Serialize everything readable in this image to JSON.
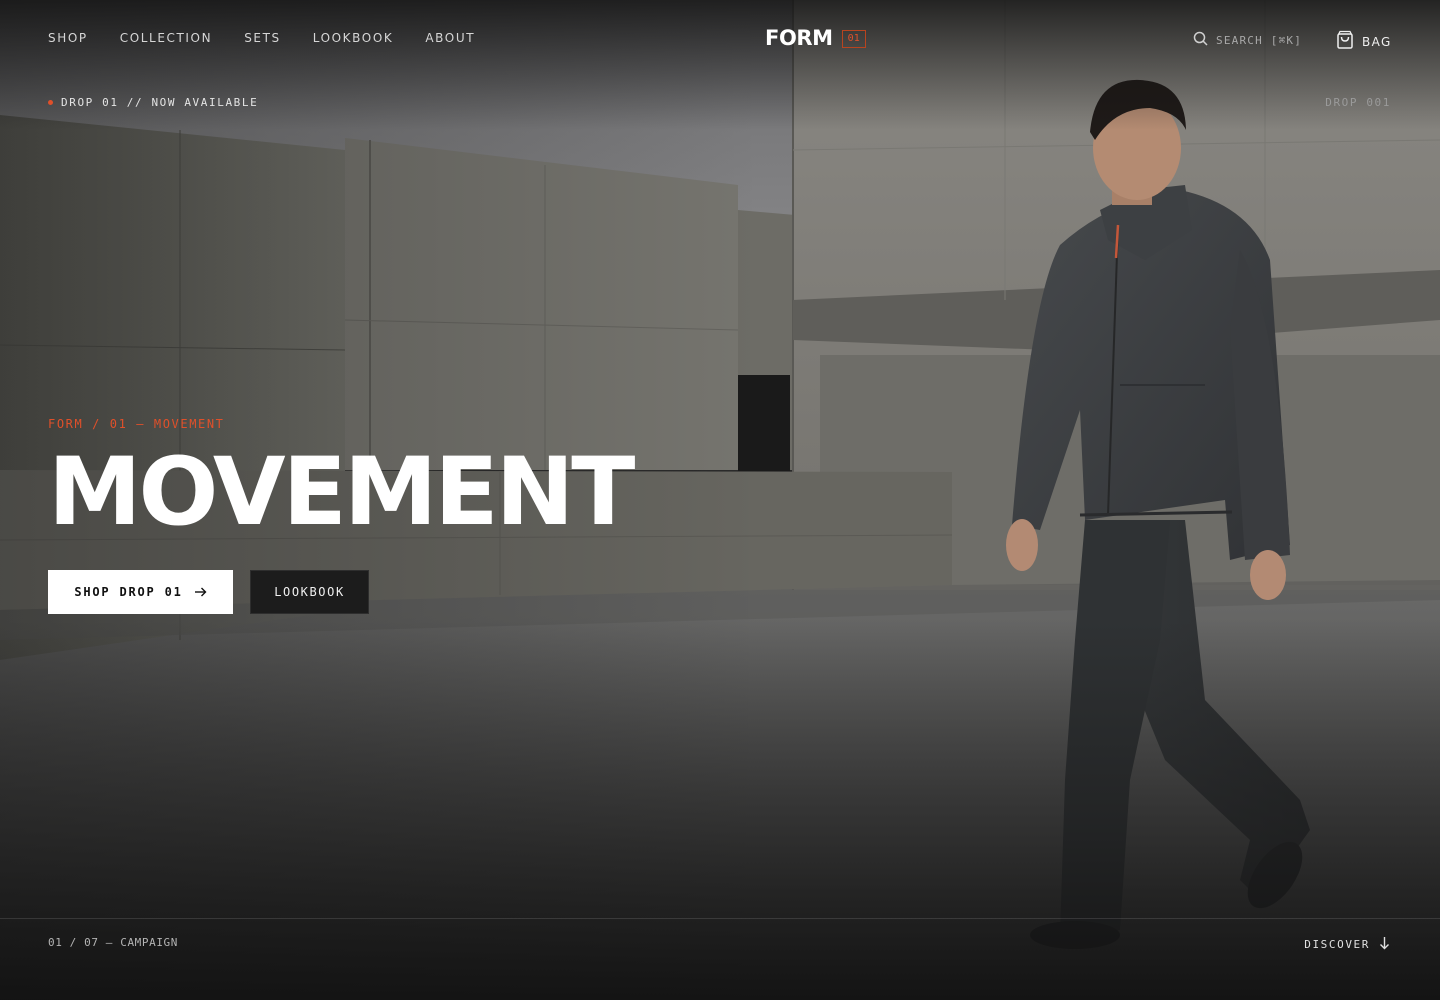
{
  "header": {
    "nav": [
      {
        "label": "SHOP"
      },
      {
        "label": "COLLECTION"
      },
      {
        "label": "SETS"
      },
      {
        "label": "LOOKBOOK"
      },
      {
        "label": "ABOUT"
      }
    ],
    "brand": {
      "name": "FORM",
      "badge": "01"
    },
    "search": {
      "label": "SEARCH [⌘K]",
      "icon": "search-icon"
    },
    "bag": {
      "label": "BAG",
      "icon": "bag-icon"
    }
  },
  "subbar": {
    "status": "DROP 01 // NOW AVAILABLE",
    "code": "DROP 001"
  },
  "hero": {
    "eyebrow": "FORM / 01 — MOVEMENT",
    "headline": "MOVEMENT",
    "primary_cta": {
      "label": "SHOP DROP 01",
      "icon": "arrow-right-icon"
    },
    "secondary_cta": {
      "label": "LOOKBOOK"
    }
  },
  "footer": {
    "counter": "01 / 07 — CAMPAIGN",
    "discover": {
      "label": "DISCOVER",
      "icon": "arrow-down-icon"
    }
  },
  "colors": {
    "accent": "#e0502a",
    "background": "#2a2a2a",
    "text": "#ffffff"
  }
}
